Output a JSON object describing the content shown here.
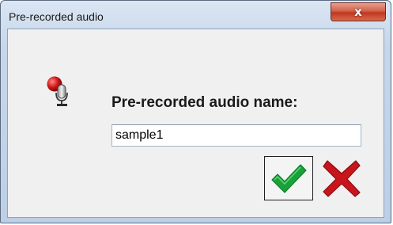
{
  "window": {
    "title": "Pre-recorded audio",
    "close_glyph": "x"
  },
  "form": {
    "prompt_label": "Pre-recorded audio name:",
    "name_value": "sample1"
  },
  "buttons": {
    "ok_icon": "green-checkmark-icon",
    "cancel_icon": "red-x-icon"
  },
  "colors": {
    "ok_green": "#1aa23a",
    "cancel_red": "#c8151c",
    "close_red": "#c0371f"
  }
}
